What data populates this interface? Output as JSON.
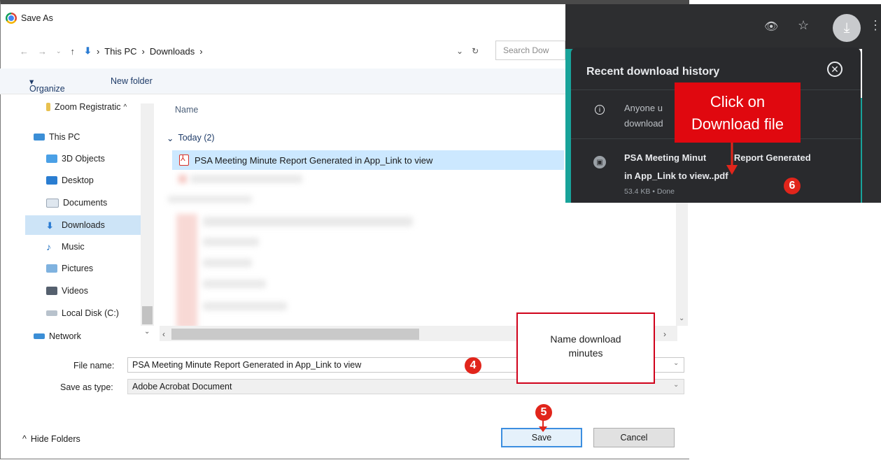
{
  "dialog": {
    "title": "Save As",
    "breadcrumb": [
      "This PC",
      "Downloads"
    ],
    "search_placeholder": "Search Dow"
  },
  "toolbar": {
    "organize": "Organize",
    "new_folder": "New folder"
  },
  "nav_pane": [
    {
      "label": "Zoom Registratic",
      "icon": "folder-icon"
    },
    {
      "label": "This PC",
      "icon": "computer-icon"
    },
    {
      "label": "3D Objects",
      "icon": "cube-icon"
    },
    {
      "label": "Desktop",
      "icon": "desktop-icon"
    },
    {
      "label": "Documents",
      "icon": "documents-icon"
    },
    {
      "label": "Downloads",
      "icon": "download-icon",
      "selected": true
    },
    {
      "label": "Music",
      "icon": "music-icon"
    },
    {
      "label": "Pictures",
      "icon": "pictures-icon"
    },
    {
      "label": "Videos",
      "icon": "videos-icon"
    },
    {
      "label": "Local Disk (C:)",
      "icon": "disk-icon"
    },
    {
      "label": "Network",
      "icon": "network-icon"
    }
  ],
  "file_list": {
    "column_name": "Name",
    "group_today": "Today (2)",
    "selected_file": "PSA Meeting Minute Report Generated in App_Link to view"
  },
  "fields": {
    "file_name_label": "File name:",
    "file_name_value": "PSA Meeting Minute Report Generated in App_Link to view",
    "save_type_label": "Save as type:",
    "save_type_value": "Adobe Acrobat Document"
  },
  "footer": {
    "hide_folders": "Hide Folders",
    "save": "Save",
    "cancel": "Cancel"
  },
  "annotations": {
    "callout": "Name download minutes",
    "badge_4": "4",
    "badge_5": "5",
    "badge_6": "6",
    "click_box_line1": "Click on",
    "click_box_line2": "Download file"
  },
  "download_panel": {
    "title": "Recent download history",
    "info_text_1": "Anyone u",
    "info_text_2": "download",
    "item_name_1": "PSA Meeting Minut",
    "item_name_1b": "Report Generated",
    "item_name_2": "in App_Link to view..pdf",
    "item_meta": "53.4 KB • Done"
  },
  "colors": {
    "annotation_red": "#e1251b",
    "chrome_dark": "#292a2d",
    "selection_blue": "#cce8ff"
  }
}
